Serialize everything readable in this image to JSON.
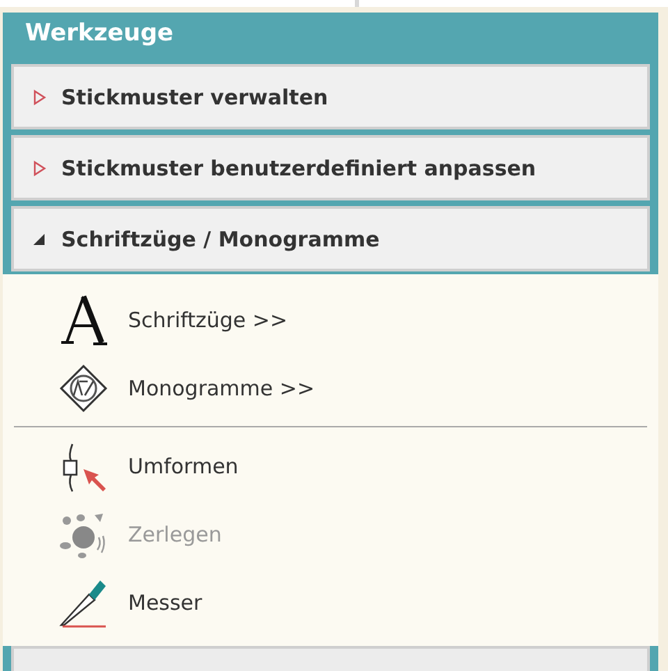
{
  "panel": {
    "title": "Werkzeuge"
  },
  "sections": [
    {
      "label": "Stickmuster verwalten",
      "expanded": false
    },
    {
      "label": "Stickmuster benutzerdefiniert anpassen",
      "expanded": false
    },
    {
      "label": "Schriftzüge / Monogramme",
      "expanded": true,
      "groups": [
        [
          {
            "kind": "letter",
            "label": "Schriftzüge >>",
            "disabled": false
          },
          {
            "kind": "monogram",
            "label": "Monogramme >>",
            "disabled": false
          }
        ],
        [
          {
            "kind": "reshape",
            "label": "Umformen",
            "disabled": false
          },
          {
            "kind": "split",
            "label": "Zerlegen",
            "disabled": true
          },
          {
            "kind": "knife",
            "label": "Messer",
            "disabled": false
          }
        ]
      ]
    }
  ]
}
